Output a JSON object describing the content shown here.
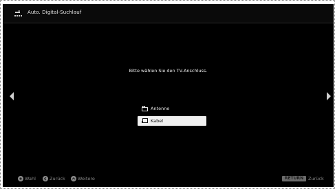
{
  "header": {
    "icon": "antenna-icon",
    "title": "Auto. Digital-Suchlauf"
  },
  "prompt": "Bitte wählen Sie den TV-Anschluss.",
  "options": [
    {
      "icon": "antenna-connector-icon",
      "label": "Antenne",
      "selected": false
    },
    {
      "icon": "cable-connector-icon",
      "label": "Kabel",
      "selected": true
    }
  ],
  "nav": {
    "left_icon": "chevron-left-icon",
    "right_icon": "chevron-right-icon"
  },
  "footer": {
    "hints": [
      {
        "icon": "select-button-icon",
        "label": "Wahl"
      },
      {
        "icon": "back-button-icon",
        "label": "Zurück"
      },
      {
        "icon": "more-button-icon",
        "label": "Weitere"
      }
    ],
    "return_key": "RETURN",
    "return_label": "Zurück"
  },
  "colors": {
    "background": "#000000",
    "selected_bg": "#f0f0f0",
    "text": "#e6e6e6",
    "footer_text": "#8a8a8a"
  }
}
